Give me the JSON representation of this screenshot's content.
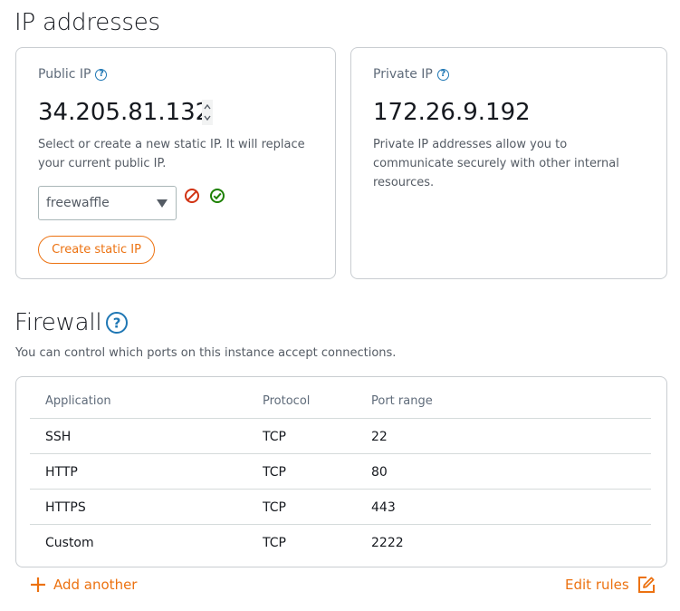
{
  "ip_section": {
    "title": "IP addresses",
    "public": {
      "label": "Public IP",
      "ip": "34.205.81.132",
      "description": "Select or create a new static IP. It will replace your current public IP.",
      "select_value": "freewaffle",
      "create_button": "Create static IP"
    },
    "private": {
      "label": "Private IP",
      "ip": "172.26.9.192",
      "description": "Private IP addresses allow you to communicate securely with other internal resources."
    }
  },
  "firewall": {
    "title": "Firewall",
    "description": "You can control which ports on this instance accept connections.",
    "columns": [
      "Application",
      "Protocol",
      "Port range"
    ],
    "rows": [
      {
        "application": "SSH",
        "protocol": "TCP",
        "port": "22"
      },
      {
        "application": "HTTP",
        "protocol": "TCP",
        "port": "80"
      },
      {
        "application": "HTTPS",
        "protocol": "TCP",
        "port": "443"
      },
      {
        "application": "Custom",
        "protocol": "TCP",
        "port": "2222"
      }
    ],
    "add_label": "Add another",
    "edit_label": "Edit rules"
  },
  "colors": {
    "accent": "#ec7211",
    "info": "#1f77b4",
    "danger": "#d13212",
    "success": "#1d8102"
  },
  "icons": [
    "help-icon",
    "stepper-icon",
    "chevron-down-icon",
    "cancel-icon",
    "check-icon",
    "plus-icon",
    "edit-icon"
  ]
}
